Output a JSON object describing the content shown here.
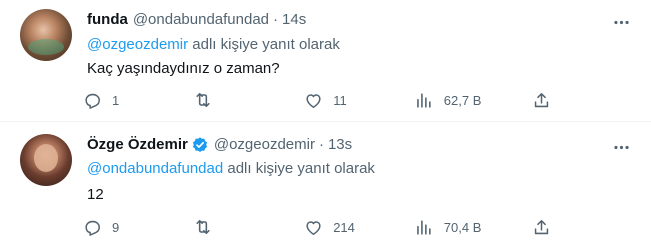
{
  "tweets": [
    {
      "name": "funda",
      "handle": "@ondabundafundad",
      "separator": "·",
      "time": "14s",
      "reply_mention": "@ozgeozdemir",
      "reply_suffix": " adlı kişiye yanıt olarak",
      "text": "Kaç yaşındaydınız o zaman?",
      "verified": false,
      "stats": {
        "replies": "1",
        "retweets": "",
        "likes": "11",
        "views": "62,7 B"
      }
    },
    {
      "name": "Özge Özdemir",
      "handle": "@ozgeozdemir",
      "separator": "·",
      "time": "13s",
      "reply_mention": "@ondabundafundad",
      "reply_suffix": " adlı kişiye yanıt olarak",
      "text": "12",
      "verified": true,
      "stats": {
        "replies": "9",
        "retweets": "",
        "likes": "214",
        "views": "70,4 B"
      }
    }
  ],
  "icons": {
    "reply": "reply-icon",
    "retweet": "retweet-icon",
    "like": "heart-icon",
    "views": "views-chart-icon",
    "share": "share-icon",
    "more": "more-dots-icon",
    "verified": "verified-badge-icon"
  },
  "colors": {
    "text": "#0f1419",
    "secondary": "#536471",
    "link": "#1d9bf0",
    "verified": "#1d9bf0",
    "divider": "#eff3f4"
  }
}
